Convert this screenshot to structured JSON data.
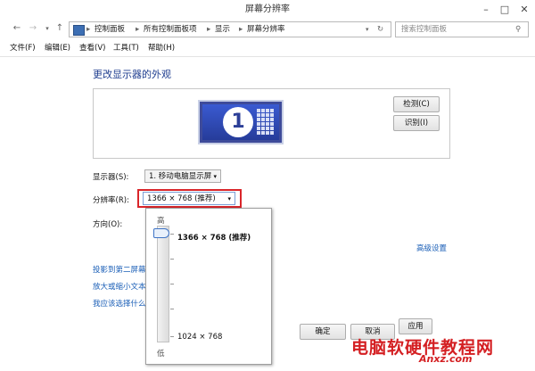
{
  "window": {
    "title": "屏幕分辨率",
    "controls": [
      "–",
      "□",
      "✕"
    ]
  },
  "nav": {
    "back": "←",
    "forward": "→",
    "up": "↑",
    "breadcrumb": [
      "控制面板",
      "所有控制面板项",
      "显示",
      "屏幕分辨率"
    ],
    "search_placeholder": "搜索控制面板"
  },
  "menu": [
    "文件(F)",
    "编辑(E)",
    "查看(V)",
    "工具(T)",
    "帮助(H)"
  ],
  "content": {
    "heading": "更改显示器的外观",
    "monitor_number": "1",
    "detect_button": "检测(C)",
    "identify_button": "识别(I)",
    "display_label": "显示器(S):",
    "display_value": "1. 移动电脑显示屏",
    "resolution_label": "分辨率(R):",
    "resolution_value": "1366 × 768 (推荐)",
    "orientation_label": "方向(O):",
    "advanced_link": "高级设置",
    "links": [
      "投影到第二屏幕",
      "放大或缩小文本",
      "我应该选择什么"
    ]
  },
  "dropdown": {
    "high_label": "高",
    "low_label": "低",
    "top_option": "1366 × 768 (推荐)",
    "bottom_option": "1024 × 768",
    "slider_level": 1.0
  },
  "footer": {
    "ok_button": "确定",
    "cancel_button": "取消",
    "apply_button": "应用"
  },
  "watermark": {
    "text": "电脑软硬件教程网",
    "logo": "Anxz.com"
  },
  "colors": {
    "accent_red": "#d9252a",
    "link_blue": "#1b5fb7",
    "heading_blue": "#1e3d8f"
  }
}
